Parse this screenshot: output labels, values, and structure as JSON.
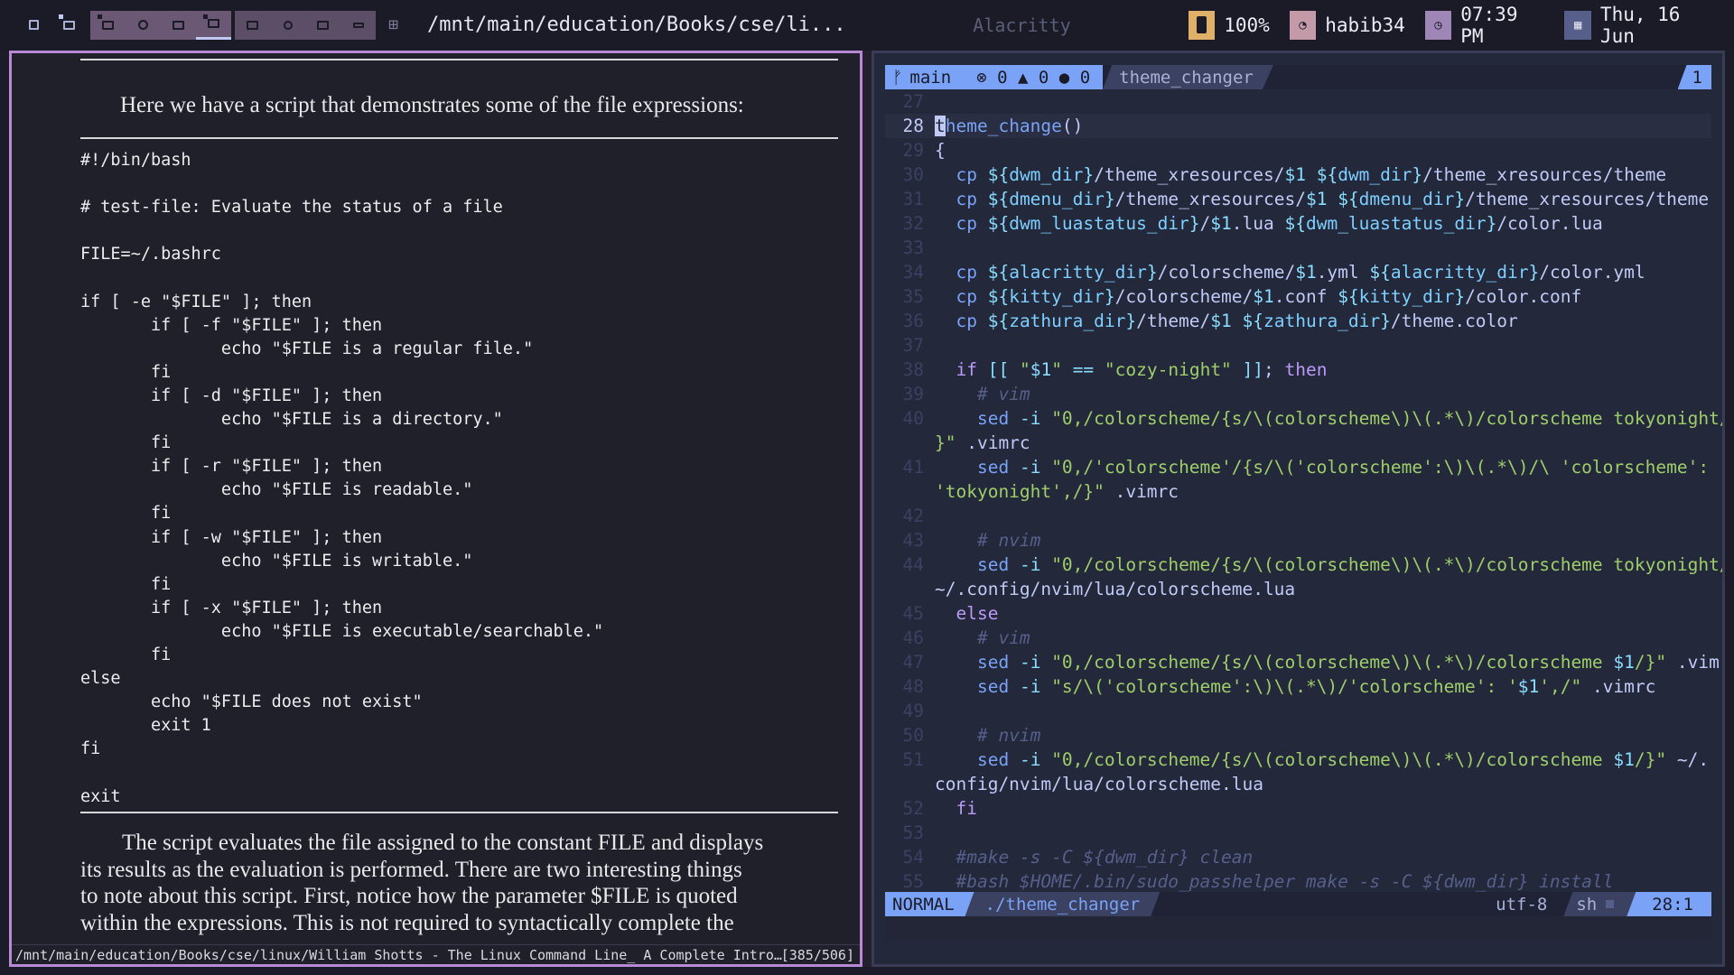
{
  "topbar": {
    "window_title": "/mnt/main/education/Books/cse/li...",
    "app_name": "Alacritty",
    "battery": "100%",
    "network": "habib34",
    "time": "07:39 PM",
    "date": "Thu, 16 Jun",
    "icons": [
      "battery-icon",
      "wifi-icon",
      "clock-icon",
      "calendar-icon"
    ]
  },
  "zathura": {
    "intro": "Here we have a script that demonstrates some of the file expressions:",
    "code": "#!/bin/bash\n\n# test-file: Evaluate the status of a file\n\nFILE=~/.bashrc\n\nif [ -e \"$FILE\" ]; then\n       if [ -f \"$FILE\" ]; then\n              echo \"$FILE is a regular file.\"\n       fi\n       if [ -d \"$FILE\" ]; then\n              echo \"$FILE is a directory.\"\n       fi\n       if [ -r \"$FILE\" ]; then\n              echo \"$FILE is readable.\"\n       fi\n       if [ -w \"$FILE\" ]; then\n              echo \"$FILE is writable.\"\n       fi\n       if [ -x \"$FILE\" ]; then\n              echo \"$FILE is executable/searchable.\"\n       fi\nelse\n       echo \"$FILE does not exist\"\n       exit 1\nfi\n\nexit",
    "para_lines": [
      "The script evaluates the file assigned to the constant FILE and displays",
      "its results as the evaluation is performed. There are two interesting things",
      "to note about this script. First, notice how the parameter $FILE is quoted",
      "within the expressions. This is not required to syntactically complete the"
    ],
    "status_path": "/mnt/main/education/Books/cse/linux/William Shotts - The Linux Command Line_ A Complete Intro…",
    "status_page": "[385/506]"
  },
  "vim": {
    "branch": "main",
    "errors": "0",
    "warnings": "0",
    "infos": "0",
    "tab_file": "theme_changer",
    "tab_number": "1",
    "mode": "NORMAL",
    "status_file": "./theme_changer",
    "encoding": "utf-8",
    "filetype": "sh",
    "position": "28:1"
  }
}
